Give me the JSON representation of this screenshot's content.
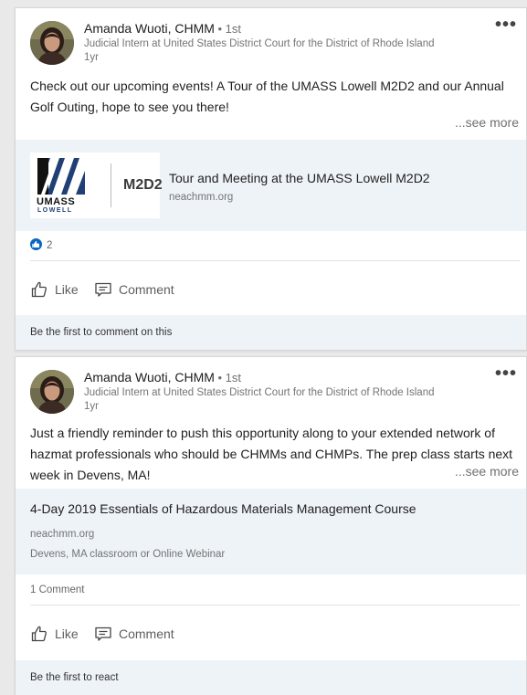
{
  "posts": [
    {
      "author": "Amanda Wuoti, CHMM",
      "degree": " • 1st",
      "headline": "Judicial Intern at United States District Court for the District of Rhode Island",
      "time": "1yr",
      "text": "Check out our upcoming events! A Tour of the UMASS Lowell M2D2 and our Annual Golf Outing, hope to see you there!",
      "see_more": "...see more",
      "link": {
        "title": "Tour and Meeting at the UMASS Lowell M2D2",
        "domain": "neachmm.org",
        "logo_umass": "UMASS",
        "logo_lowell": "LOWELL",
        "logo_m2d2": "M2D2"
      },
      "reaction_count": "2",
      "actions": {
        "like": "Like",
        "comment": "Comment"
      },
      "footer": "Be the first to comment on this"
    },
    {
      "author": "Amanda Wuoti, CHMM",
      "degree": " • 1st",
      "headline": "Judicial Intern at United States District Court for the District of Rhode Island",
      "time": "1yr",
      "text": "Just a friendly reminder to push this opportunity along to your extended network of hazmat professionals who should be CHMMs and CHMPs. The prep class starts next week in Devens, MA!",
      "see_more": "...see more",
      "link": {
        "title": "4-Day 2019 Essentials of Hazardous Materials Management Course",
        "domain": "neachmm.org",
        "location": "Devens, MA classroom or Online Webinar"
      },
      "comment_count": "1 Comment",
      "actions": {
        "like": "Like",
        "comment": "Comment"
      },
      "footer": "Be the first to react"
    }
  ],
  "icons": {
    "menu": "more-options-icon",
    "like": "thumbs-up-icon",
    "comment": "comment-icon",
    "reaction": "like-reaction-icon"
  },
  "colors": {
    "link_bg": "#eef3f8",
    "accent": "#0a66c2"
  }
}
